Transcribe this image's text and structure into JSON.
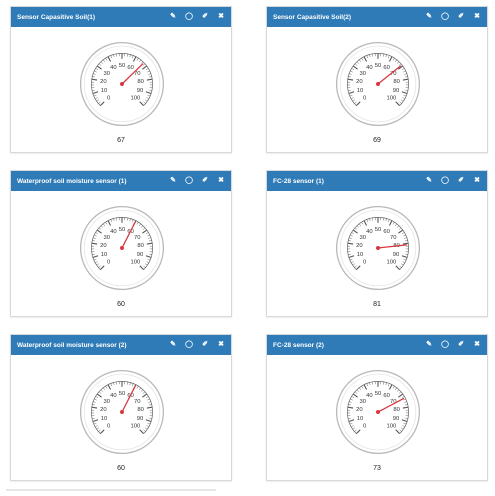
{
  "widgets": [
    {
      "title": "Sensor Capasitive Soil(1)",
      "value": "67",
      "reading": 67
    },
    {
      "title": "Sensor Capasitive Soil(2)",
      "value": "69",
      "reading": 69
    },
    {
      "title": "Waterproof soil moisture sensor (1)",
      "value": "60",
      "reading": 60
    },
    {
      "title": "FC-28 sensor (1)",
      "value": "81",
      "reading": 81
    },
    {
      "title": "Waterproof soil moisture sensor (2)",
      "value": "60",
      "reading": 60
    },
    {
      "title": "FC-28 sensor (2)",
      "value": "73",
      "reading": 73
    }
  ],
  "gauge": {
    "min": 0,
    "max": 100,
    "tick_labels": [
      "0",
      "10",
      "20",
      "30",
      "40",
      "50",
      "60",
      "70",
      "80",
      "90",
      "100"
    ],
    "needle_color": "#d9363e",
    "header_color": "#2f7bb8"
  },
  "icons": [
    "edit-icon",
    "comment-icon",
    "pencil-icon",
    "close-icon"
  ]
}
